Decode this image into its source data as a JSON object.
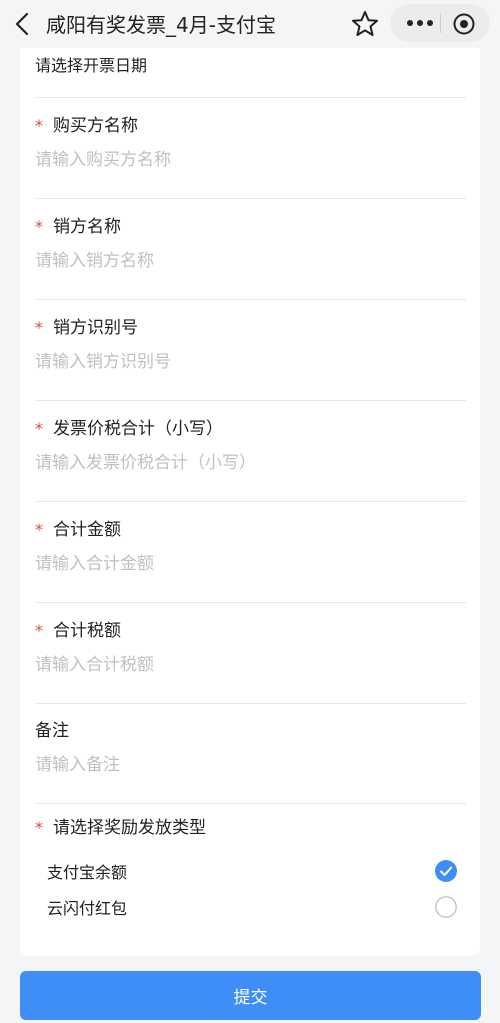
{
  "nav": {
    "title": "咸阳有奖发票_4月-支付宝"
  },
  "form": {
    "date_label": "请选择开票日期",
    "required_mark": "*",
    "fields": [
      {
        "label": "购买方名称",
        "placeholder": "请输入购买方名称",
        "required": true
      },
      {
        "label": "销方名称",
        "placeholder": "请输入销方名称",
        "required": true
      },
      {
        "label": "销方识别号",
        "placeholder": "请输入销方识别号",
        "required": true
      },
      {
        "label": "发票价税合计（小写）",
        "placeholder": "请输入发票价税合计（小写）",
        "required": true
      },
      {
        "label": "合计金额",
        "placeholder": "请输入合计金额",
        "required": true
      },
      {
        "label": "合计税额",
        "placeholder": "请输入合计税额",
        "required": true
      },
      {
        "label": "备注",
        "placeholder": "请输入备注",
        "required": false
      }
    ],
    "reward": {
      "title": "请选择奖励发放类型",
      "options": [
        {
          "label": "支付宝余额",
          "selected": true
        },
        {
          "label": "云闪付红包",
          "selected": false
        }
      ]
    }
  },
  "submit_label": "提交",
  "colors": {
    "accent": "#3f8ef7",
    "required": "#e24a3b",
    "placeholder": "#c0c0c0"
  }
}
